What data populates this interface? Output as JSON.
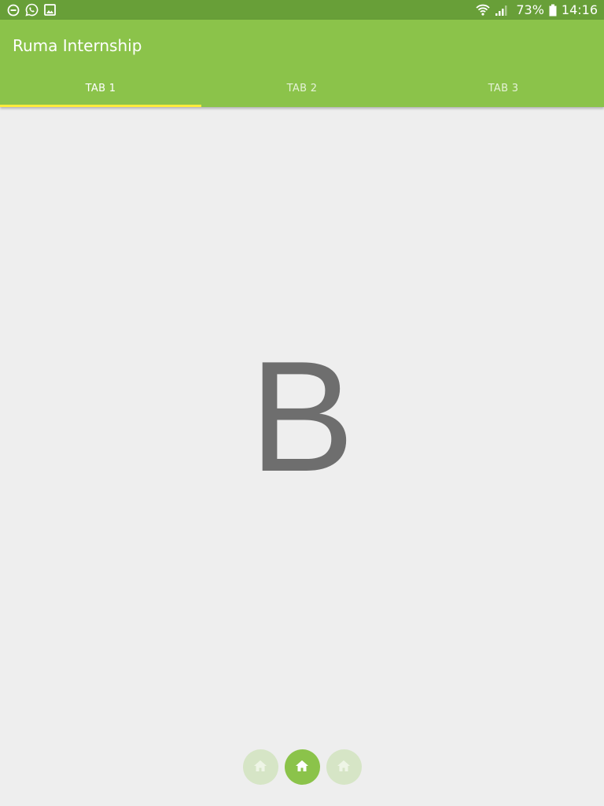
{
  "status_bar": {
    "battery_percent": "73%",
    "time": "14:16",
    "left_icons": [
      "do-not-disturb-icon",
      "whatsapp-icon",
      "gallery-icon"
    ],
    "right_icons": [
      "wifi-icon",
      "signal-icon",
      "battery-icon"
    ]
  },
  "app_bar": {
    "title": "Ruma Internship",
    "color": "#8bc34a",
    "dark_color": "#689f38",
    "indicator_color": "#ffeb3b"
  },
  "tabs": [
    {
      "label": "TAB 1",
      "active": true
    },
    {
      "label": "TAB 2",
      "active": false
    },
    {
      "label": "TAB 3",
      "active": false
    }
  ],
  "content": {
    "letter": "B"
  },
  "page_indicator": {
    "icon": "home-icon",
    "active_index": 1,
    "count": 3
  }
}
